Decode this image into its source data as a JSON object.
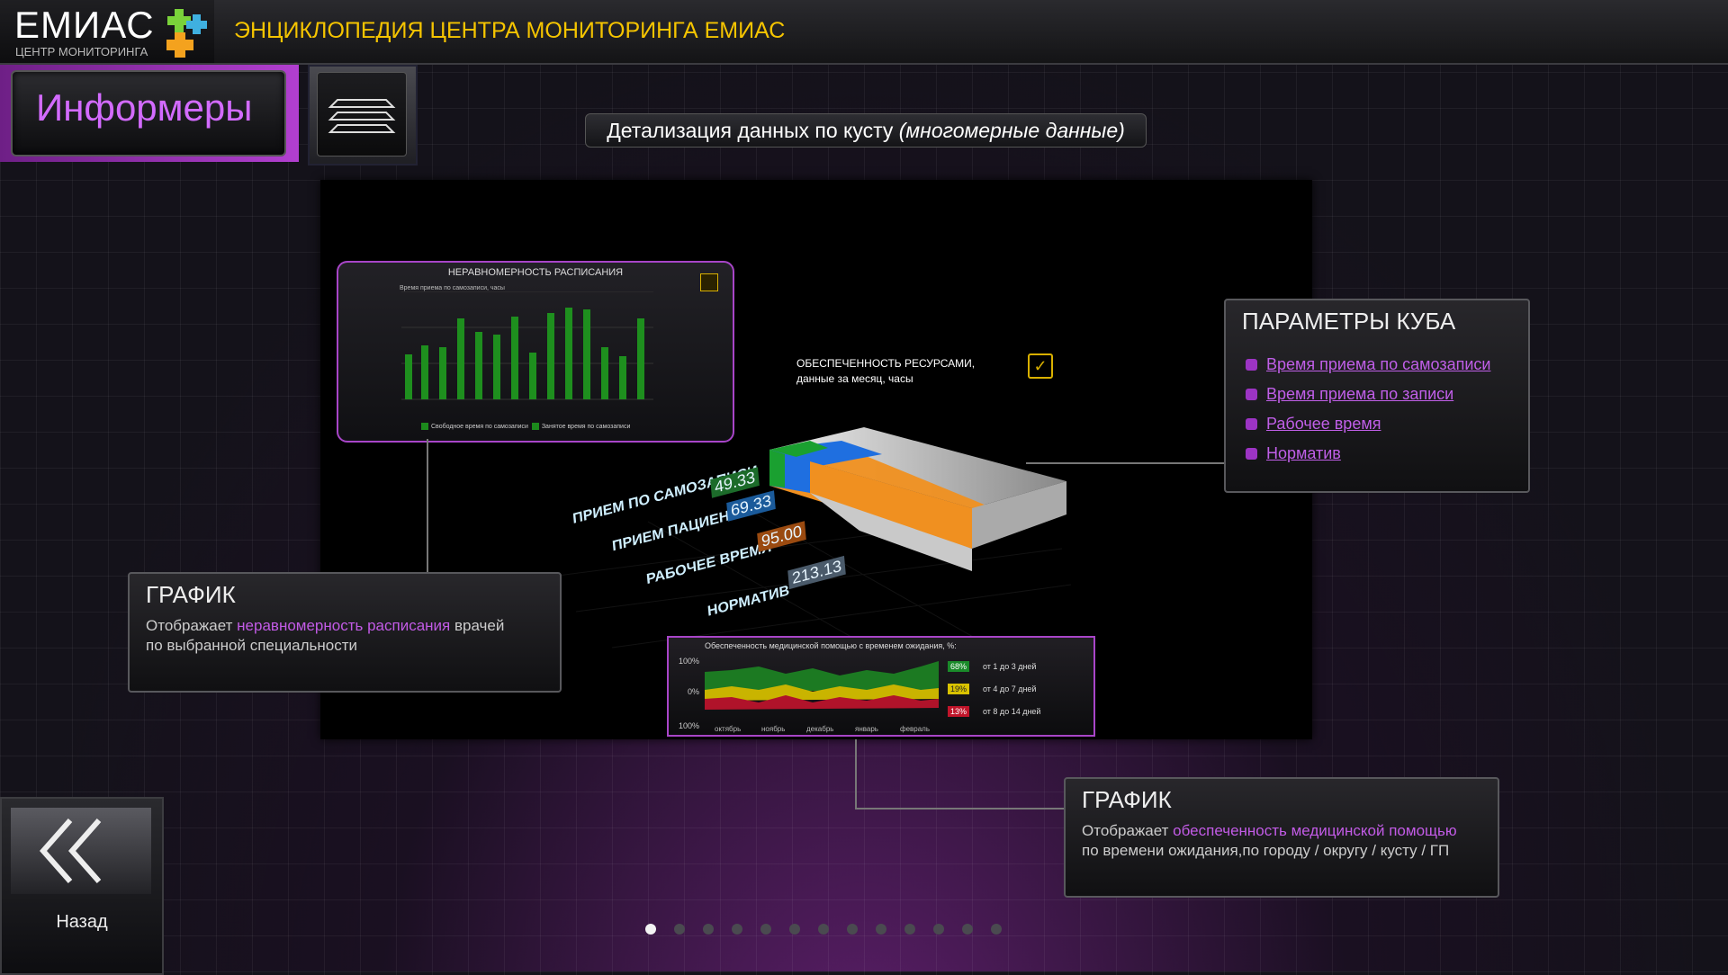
{
  "header": {
    "logo": "ЕМИАС",
    "logo_sub": "ЦЕНТР МОНИТОРИНГА",
    "title": "ЭНЦИКЛОПЕДИЯ ЦЕНТРА МОНИТОРИНГА ЕМИАС"
  },
  "section": {
    "label": "Информеры"
  },
  "subtitle": {
    "main": "Детализация данных по кусту ",
    "italic": "(многомерные данные)"
  },
  "mini_chart": {
    "title": "НЕРАВНОМЕРНОСТЬ РАСПИСАНИЯ",
    "subtitle": "Время приема по самозаписи, часы",
    "legend_free": "Свободное время по самозаписи",
    "legend_busy": "Занятое время по самозаписи"
  },
  "cube": {
    "title_line1": "ОБЕСПЕЧЕННОСТЬ РЕСУРСАМИ,",
    "title_line2": "данные за месяц, часы",
    "rows": [
      {
        "label": "ПРИЕМ ПО САМОЗАПИСИ",
        "value": "49.33"
      },
      {
        "label": "ПРИЕМ ПАЦИЕНТОВ",
        "value": "69.33"
      },
      {
        "label": "РАБОЧЕЕ ВРЕМЯ",
        "value": "95.00"
      },
      {
        "label": "НОРМАТИВ",
        "value": "213.13"
      }
    ]
  },
  "area_chart": {
    "title": "Обеспеченность медицинской помощью с временем ожидания, %:",
    "y_top": "100%",
    "y_mid": "0%",
    "y_bottom": "100%",
    "months": [
      "октябрь",
      "ноябрь",
      "декабрь",
      "январь",
      "февраль"
    ],
    "badges": [
      {
        "value": "68%",
        "text": "от 1 до 3 дней",
        "color": "#1a8a2a"
      },
      {
        "value": "19%",
        "text": "от 4 до 7 дней",
        "color": "#d9c200"
      },
      {
        "value": "13%",
        "text": "от 8 до 14 дней",
        "color": "#c0142a"
      }
    ]
  },
  "cube_params": {
    "title": "ПАРАМЕТРЫ КУБА",
    "items": [
      "Время приема по самозаписи",
      "Время приема по записи",
      "Рабочее время",
      "Норматив"
    ]
  },
  "panel_left": {
    "title": "ГРАФИК",
    "pre": "Отображает ",
    "highlight": "неравномерность расписания",
    "post": " врачей",
    "line2": "по выбранной специальности"
  },
  "panel_right": {
    "title": "ГРАФИК",
    "pre": "Отображает ",
    "highlight": "обеспеченность медицинской помощью",
    "line2": "по времени ожидания,по городу / округу / кусту / ГП"
  },
  "back": {
    "label": "Назад"
  },
  "pagination": {
    "count": 13,
    "active": 1
  },
  "colors": {
    "accent": "#c25be6",
    "title": "#f5c400"
  }
}
